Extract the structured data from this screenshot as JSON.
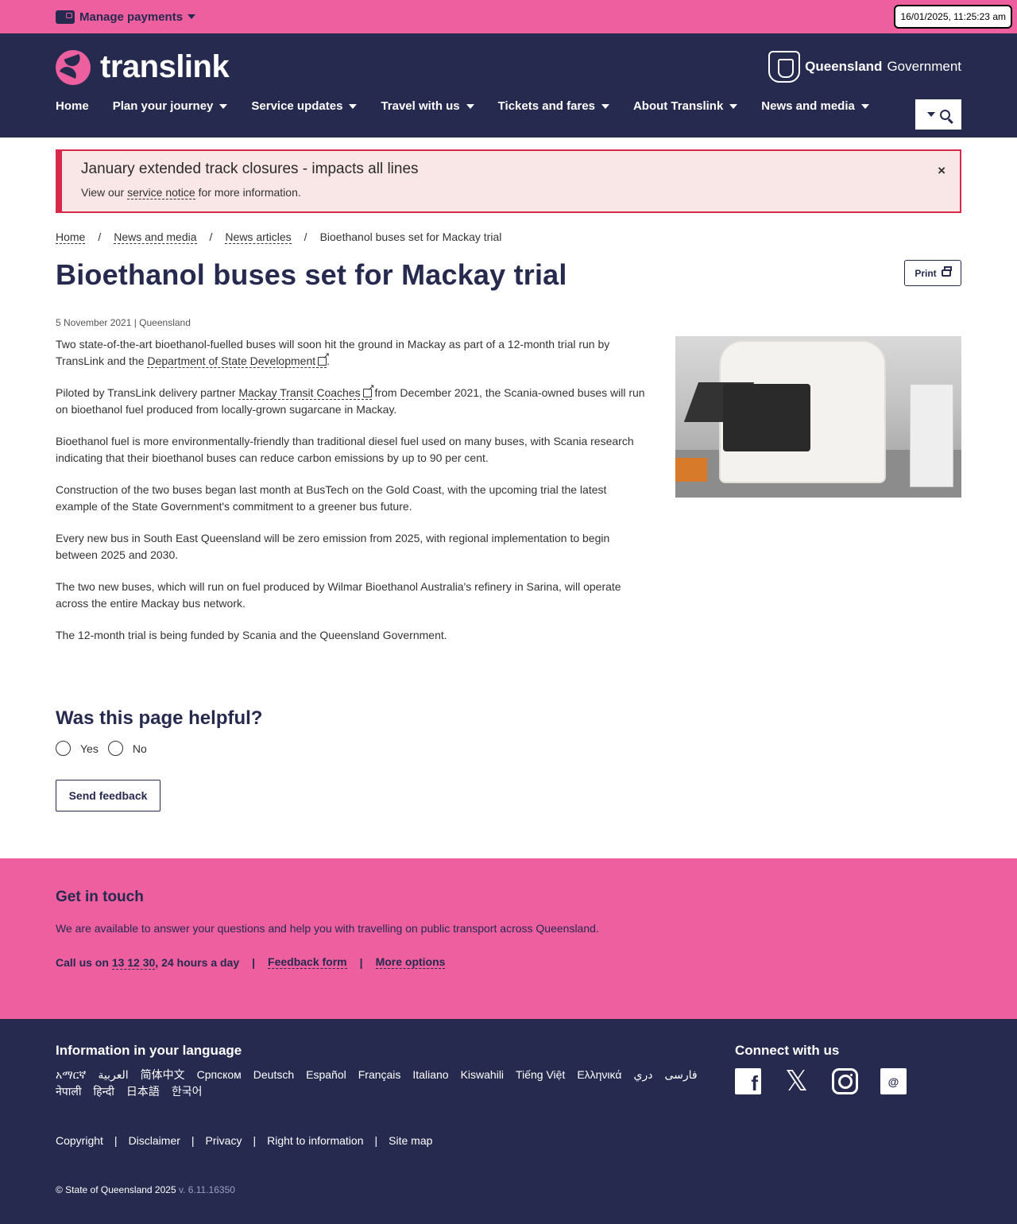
{
  "topbar": {
    "manage_label": "Manage payments",
    "datetime": "16/01/2025, 11:25:23 am"
  },
  "header": {
    "logo_text": "translink",
    "gov_bold": "Queensland",
    "gov_light": "Government",
    "nav": [
      "Home",
      "Plan your journey",
      "Service updates",
      "Travel with us",
      "Tickets and fares",
      "About Translink",
      "News and media"
    ]
  },
  "alert": {
    "title": "January extended track closures - impacts all lines",
    "text_before": "View our ",
    "link": "service notice",
    "text_after": " for more information.",
    "close": "×"
  },
  "breadcrumb": {
    "home": "Home",
    "news_media": "News and media",
    "news_articles": "News articles",
    "current": "Bioethanol buses set for Mackay trial",
    "sep": "/"
  },
  "article": {
    "title": "Bioethanol buses set for Mackay trial",
    "print_label": "Print",
    "meta": "5 November 2021 | Queensland",
    "p1_before": "Two state-of-the-art bioethanol-fuelled buses will soon hit the ground in Mackay as part of a 12-month trial run by TransLink and the ",
    "p1_link": "Department of State Development",
    "p1_after": ".",
    "p2_before": "Piloted by TransLink delivery partner ",
    "p2_link": "Mackay Transit Coaches",
    "p2_after": " from December 2021, the Scania-owned buses will run on bioethanol fuel produced from locally-grown sugarcane in Mackay.",
    "p3": "Bioethanol fuel is more environmentally-friendly than traditional diesel fuel used on many buses, with Scania research indicating that their bioethanol buses can reduce carbon emissions by up to 90 per cent.",
    "p4": "Construction of the two buses began last month at BusTech on the Gold Coast, with the upcoming trial the latest example of the State Government's commitment to a greener bus future.",
    "p5": "Every new bus in South East Queensland will be zero emission from 2025, with regional implementation to begin between 2025 and 2030.",
    "p6": "The two new buses, which will run on fuel produced by Wilmar Bioethanol Australia's refinery in Sarina, will operate across the entire Mackay bus network.",
    "p7": "The 12-month trial is being funded by Scania and the Queensland Government."
  },
  "feedback": {
    "heading": "Was this page helpful?",
    "yes": "Yes",
    "no": "No",
    "send": "Send feedback"
  },
  "touch": {
    "heading": "Get in touch",
    "text": "We are available to answer your questions and help you with travelling on public transport across Queensland.",
    "call_before": "Call us on ",
    "call_number": "13 12 30",
    "call_after": ", 24 hours a day",
    "sep": "|",
    "feedback_form": "Feedback form",
    "more_options": "More options"
  },
  "footer": {
    "lang_heading": "Information in your language",
    "languages": [
      "አማርኛ",
      "العربية",
      "简体中文",
      "Српском",
      "Deutsch",
      "Español",
      "Français",
      "Italiano",
      "Kiswahili",
      "Tiếng Việt",
      "Ελληνικά",
      "دري",
      "فارسی",
      "नेपाली",
      "हिन्दी",
      "日本語",
      "한국어"
    ],
    "connect_heading": "Connect with us",
    "legal": [
      "Copyright",
      "Disclaimer",
      "Privacy",
      "Right to information",
      "Site map"
    ],
    "legal_sep": "|",
    "copyright": "© State of Queensland 2025",
    "version": "v. 6.11.16350"
  }
}
